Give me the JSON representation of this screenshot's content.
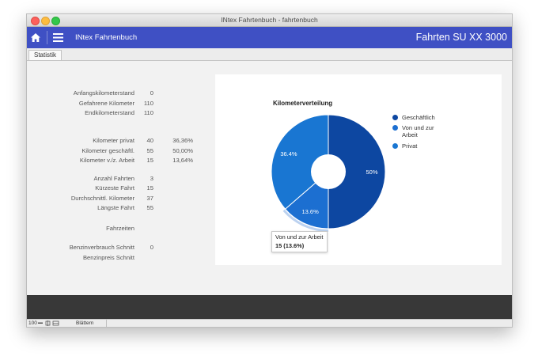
{
  "window": {
    "title": "INtex Fahrtenbuch - fahrtenbuch"
  },
  "appbar": {
    "app_name": "INtex Fahrtenbuch",
    "vehicle": "Fahrten SU XX 3000"
  },
  "tabs": [
    {
      "label": "Statistik"
    }
  ],
  "stats": {
    "group1": [
      {
        "label": "Anfangskilometerstand",
        "value": "0"
      },
      {
        "label": "Gefahrene Kilometer",
        "value": "110"
      },
      {
        "label": "Endkilometerstand",
        "value": "110"
      }
    ],
    "group2": [
      {
        "label": "Kilometer privat",
        "value": "40",
        "pct": "36,36%"
      },
      {
        "label": "Kilometer geschäftl.",
        "value": "55",
        "pct": "50,00%"
      },
      {
        "label": "Kilometer v./z. Arbeit",
        "value": "15",
        "pct": "13,64%"
      }
    ],
    "group3": [
      {
        "label": "Anzahl Fahrten",
        "value": "3"
      },
      {
        "label": "Kürzeste Fahrt",
        "value": "15"
      },
      {
        "label": "Durchschnittl. Kilometer",
        "value": "37"
      },
      {
        "label": "Längste Fahrt",
        "value": "55"
      }
    ],
    "fahrzeiten_label": "Fahrzeiten",
    "group4": [
      {
        "label": "Benzinverbrauch Schnitt",
        "value": "0"
      },
      {
        "label": "Benzinpreis Schnitt",
        "value": ""
      }
    ]
  },
  "chart_data": {
    "type": "pie",
    "title": "Kilometerverteilung",
    "categories": [
      "Geschäftlich",
      "Von und zur Arbeit",
      "Privat"
    ],
    "values": [
      55,
      15,
      40
    ],
    "percent_labels": [
      "50%",
      "13.6%",
      "36.4%"
    ],
    "colors": [
      "#0d47a1",
      "#1c6fd1",
      "#1976d2"
    ],
    "donut": true,
    "legend_position": "right",
    "highlighted": "Von und zur Arbeit"
  },
  "tooltip": {
    "title": "Von und zur Arbeit",
    "value": "15 (13.6%)"
  },
  "statusbar": {
    "zoom": "100",
    "mode": "Blättern"
  }
}
